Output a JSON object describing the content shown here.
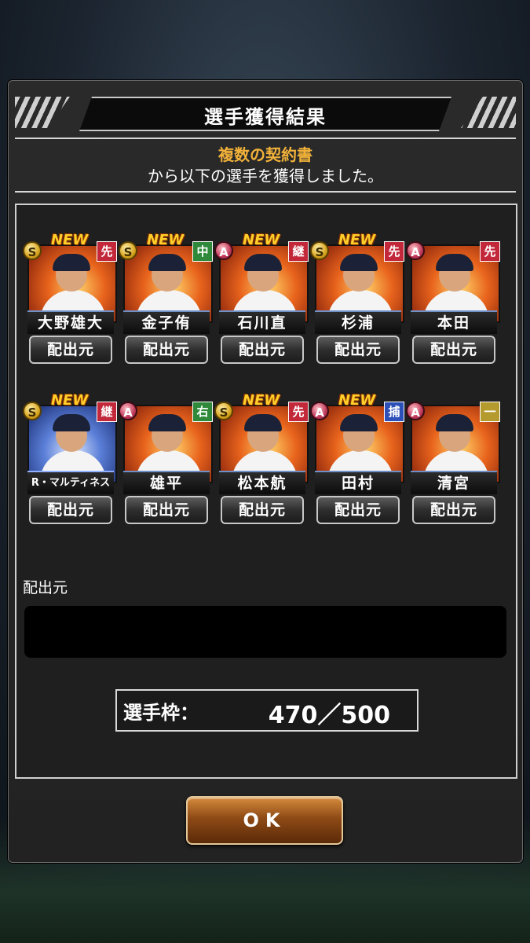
{
  "dialog": {
    "title": "選手獲得結果",
    "subtitle_highlight": "複数の契約書",
    "subtitle_text": "から以下の選手を獲得しました。",
    "source_label": "配出元",
    "slots_label": "選手枠：",
    "slots_value": "470／500",
    "ok_label": "OK"
  },
  "players": [
    {
      "name": "大野雄大",
      "rank": "S",
      "new": "NEW",
      "pos": "先",
      "pos_color": "#c2283a",
      "theme": "fire",
      "button": "配出元"
    },
    {
      "name": "金子侑",
      "rank": "S",
      "new": "NEW",
      "pos": "中",
      "pos_color": "#2e8a3a",
      "theme": "fire",
      "button": "配出元"
    },
    {
      "name": "石川直",
      "rank": "A",
      "new": "NEW",
      "pos": "継",
      "pos_color": "#c2283a",
      "theme": "fire",
      "button": "配出元"
    },
    {
      "name": "杉浦",
      "rank": "S",
      "new": "NEW",
      "pos": "先",
      "pos_color": "#c2283a",
      "theme": "fire",
      "button": "配出元"
    },
    {
      "name": "本田",
      "rank": "A",
      "new": "",
      "pos": "先",
      "pos_color": "#c2283a",
      "theme": "fire",
      "button": "配出元"
    },
    {
      "name": "R・マルティネス",
      "rank": "S",
      "new": "NEW",
      "pos": "継",
      "pos_color": "#c2283a",
      "theme": "blue",
      "button": "配出元"
    },
    {
      "name": "雄平",
      "rank": "A",
      "new": "",
      "pos": "右",
      "pos_color": "#2e8a3a",
      "theme": "fire",
      "button": "配出元"
    },
    {
      "name": "松本航",
      "rank": "S",
      "new": "NEW",
      "pos": "先",
      "pos_color": "#c2283a",
      "theme": "fire",
      "button": "配出元"
    },
    {
      "name": "田村",
      "rank": "A",
      "new": "NEW",
      "pos": "捕",
      "pos_color": "#2d4fb8",
      "theme": "fire",
      "button": "配出元"
    },
    {
      "name": "清宮",
      "rank": "A",
      "new": "",
      "pos": "一",
      "pos_color": "#b59a2e",
      "theme": "fire",
      "button": "配出元"
    }
  ]
}
